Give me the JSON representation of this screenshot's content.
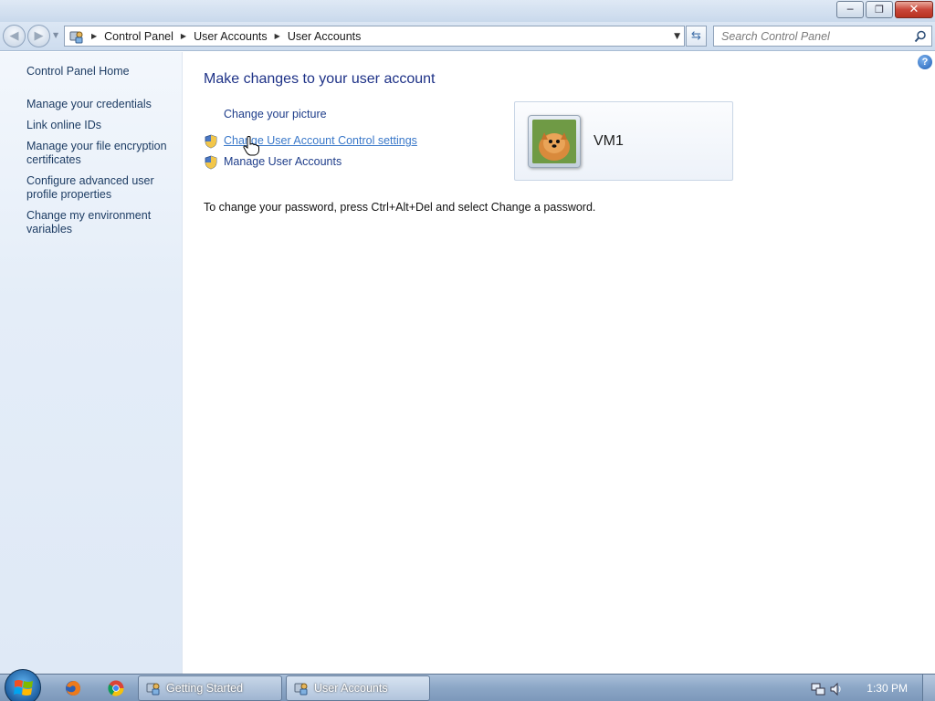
{
  "window": {
    "minimize_glyph": "─",
    "maximize_glyph": "❐",
    "close_glyph": "✕"
  },
  "address_bar": {
    "breadcrumbs": [
      "Control Panel",
      "User Accounts",
      "User Accounts"
    ],
    "search_placeholder": "Search Control Panel"
  },
  "sidebar": {
    "items": [
      {
        "label": "Control Panel Home"
      },
      {
        "label": "Manage your credentials"
      },
      {
        "label": "Link online IDs"
      },
      {
        "label": "Manage your file encryption certificates"
      },
      {
        "label": "Configure advanced user profile properties"
      },
      {
        "label": "Change my environment variables"
      }
    ]
  },
  "main": {
    "heading": "Make changes to your user account",
    "tasks": [
      {
        "label": "Change your picture",
        "shield": false
      },
      {
        "label": "Change User Account Control settings",
        "shield": true
      },
      {
        "label": "Manage User Accounts",
        "shield": true
      }
    ],
    "note": "To change your password, press Ctrl+Alt+Del and select Change a password.",
    "user": {
      "name": "VM1"
    }
  },
  "taskbar": {
    "tasks": [
      {
        "label": "Getting Started",
        "icon": "control-panel-icon"
      },
      {
        "label": "User Accounts",
        "icon": "user-accounts-icon"
      }
    ],
    "pinned": [
      "firefox-icon",
      "chrome-icon"
    ],
    "clock": "1:30 PM"
  },
  "colors": {
    "link": "#1e3d8a",
    "heading": "#1e3287",
    "sidebar_bg": "#e4edf8",
    "taskbar": "#8ba6c6"
  }
}
